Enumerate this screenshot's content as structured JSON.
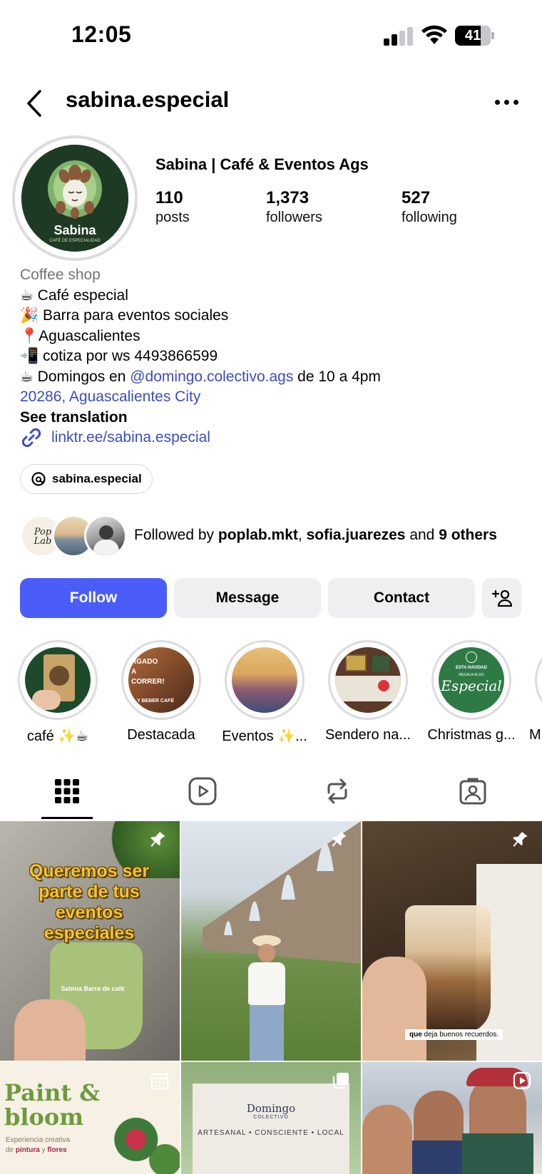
{
  "status_bar": {
    "time": "12:05",
    "battery": "41"
  },
  "header": {
    "username": "sabina.especial",
    "back_icon": "chevron-left-icon",
    "more_icon": "more-horizontal-icon"
  },
  "profile": {
    "avatar_brand": "Sabina",
    "avatar_tagline": "CAFÉ DE ESPECIALIDAD",
    "display_name": "Sabina | Café & Eventos Ags",
    "stats": [
      {
        "value": "110",
        "label": "posts"
      },
      {
        "value": "1,373",
        "label": "followers"
      },
      {
        "value": "527",
        "label": "following"
      }
    ]
  },
  "bio": {
    "category": "Coffee shop",
    "line1": "☕ Café especial",
    "line2": "🎉 Barra para eventos sociales",
    "line3": "📍Aguascalientes",
    "line4": "📲 cotiza por ws 4493866599",
    "line5_prefix": "☕ Domingos en ",
    "line5_mention": "@domingo.colectivo.ags",
    "line5_suffix": " de 10 a 4pm",
    "location": "20286, Aguascalientes City",
    "see_translation": "See translation",
    "link": "linktr.ee/sabina.especial"
  },
  "threads": {
    "handle": "sabina.especial"
  },
  "followed_by": {
    "prefix": "Followed by ",
    "user1": "poplab.mkt",
    "sep": ", ",
    "user2": "sofia.juarezes",
    "mid": " and ",
    "others": "9 others",
    "avatar1_text": "Pop Lab"
  },
  "actions": {
    "follow": "Follow",
    "message": "Message",
    "contact": "Contact"
  },
  "highlights": [
    {
      "label": "café ✨☕"
    },
    {
      "label": "Destacada"
    },
    {
      "label": "Eventos ✨..."
    },
    {
      "label": "Sendero na..."
    },
    {
      "label": "Christmas g..."
    },
    {
      "label": "M"
    }
  ],
  "highlight_texts": {
    "h2_top": "RGADO A CORRER!",
    "h2_bottom": "Y BEBER CAFÉ",
    "h5_top": "ESTA NAVIDAD",
    "h5_mid": "REGALA ALGO",
    "h5_script": "Especial"
  },
  "posts": {
    "p1_text": "Queremos ser parte de tus eventos especiales",
    "p1_small": "Sabina Barra de café",
    "p3_caption_bold": "que",
    "p3_caption": " deja buenos recuerdos.",
    "p4_title1": "Paint &",
    "p4_title2": "bloom",
    "p4_sub1": "Experiencia creativa",
    "p4_sub2_prefix": "de ",
    "p4_sub2_a": "pintura",
    "p4_sub2_mid": " y ",
    "p4_sub2_b": "flores",
    "p5_brand": "Domingo",
    "p5_brand_sub": "COLECTIVO",
    "p5_tagline": "ARTESANAL • CONSCIENTE • LOCAL"
  },
  "colors": {
    "follow_button": "#4a5df9",
    "link": "#3a4cc7",
    "secondary_button": "#efeff1",
    "category_text": "#737373"
  }
}
